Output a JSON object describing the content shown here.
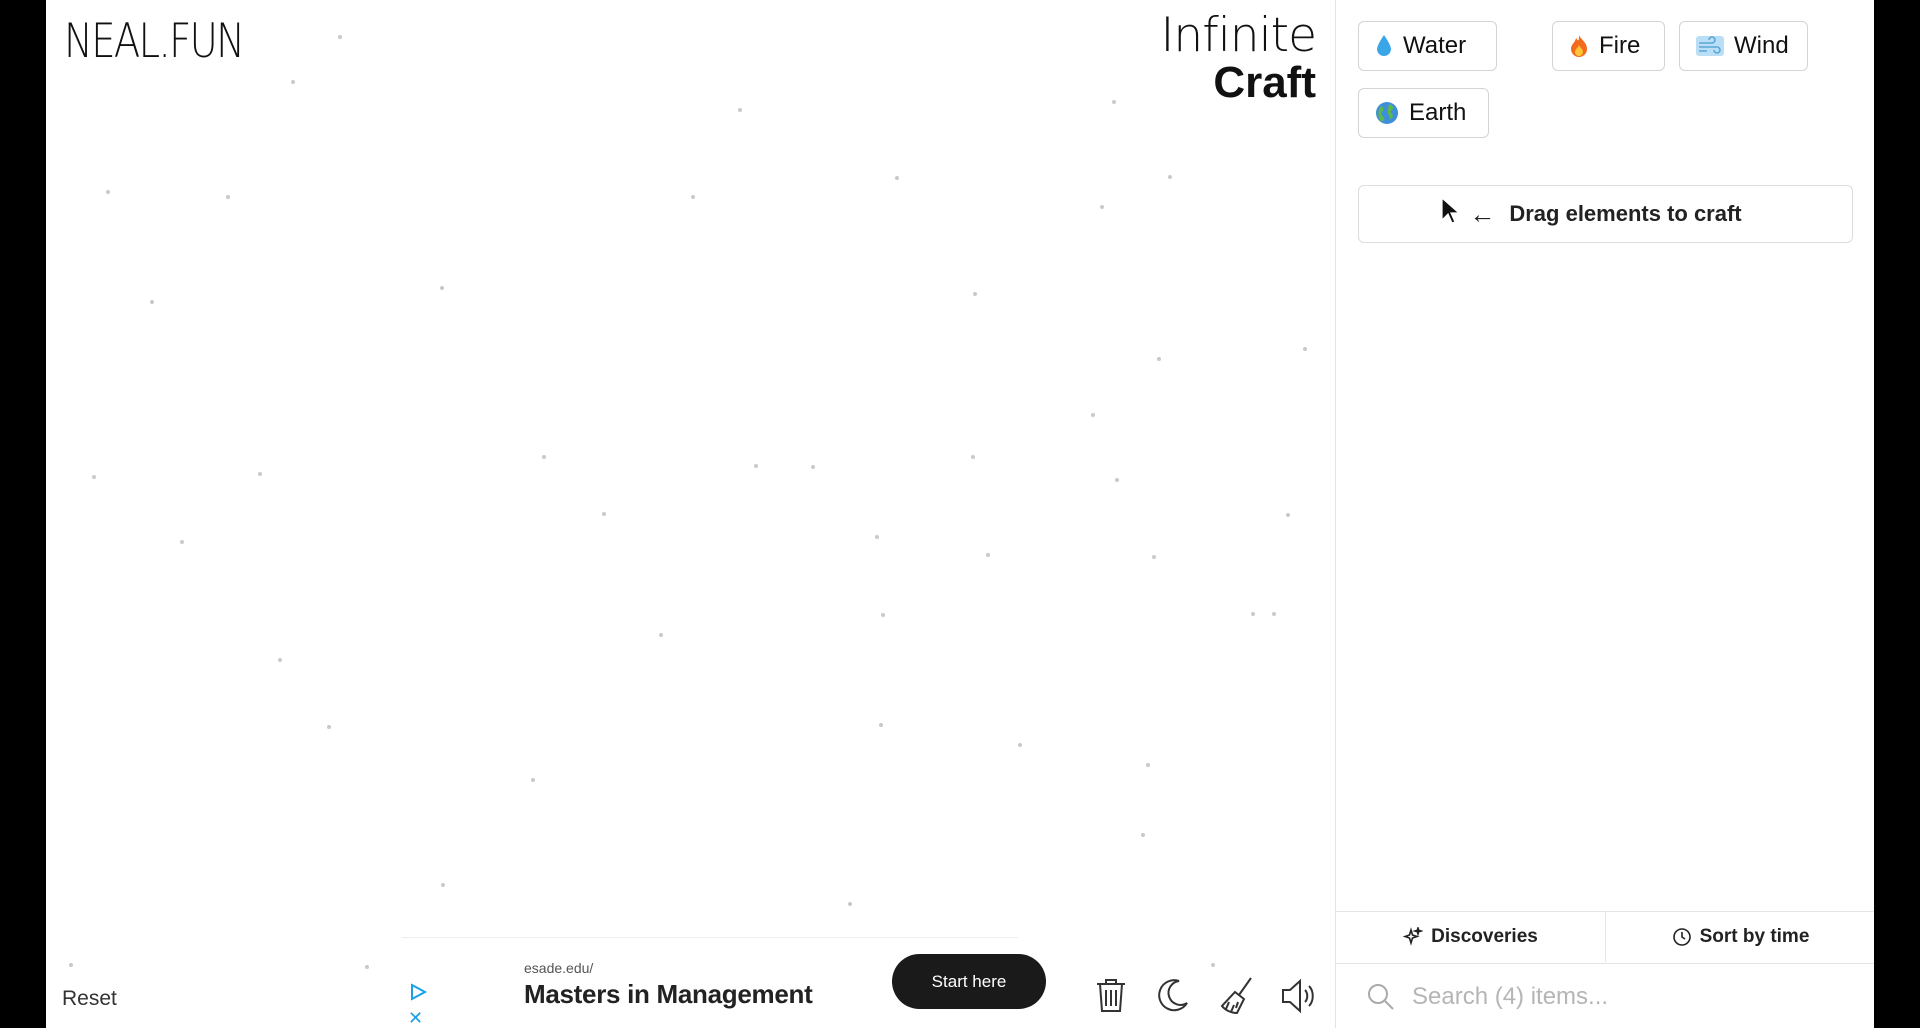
{
  "branding": {
    "logo": "NEAL.FUN",
    "title_line1": "Infinite",
    "title_line2": "Craft"
  },
  "canvas": {
    "reset_label": "Reset"
  },
  "ad": {
    "url": "esade.edu/",
    "headline": "Masters in Management",
    "cta": "Start here",
    "close_symbol": "✕"
  },
  "toolbar": {
    "icons": [
      "trash-icon",
      "moon-icon",
      "broom-icon",
      "speaker-icon"
    ]
  },
  "sidebar": {
    "items": [
      {
        "label": "Water",
        "emoji": "💧"
      },
      {
        "label": "Fire",
        "emoji": "🔥"
      },
      {
        "label": "Wind",
        "emoji": "🌬️"
      },
      {
        "label": "Earth",
        "emoji": "🌍"
      }
    ],
    "drag_hint": "Drag elements to craft",
    "drag_hint_arrow": "←",
    "tabs": {
      "discoveries": "Discoveries",
      "sort": "Sort by time"
    },
    "search_placeholder": "Search (4) items..."
  },
  "colors": {
    "accent": "#1aa0e6",
    "border": "#d4d4d4",
    "ad_cta_bg": "#1a1a1a"
  }
}
